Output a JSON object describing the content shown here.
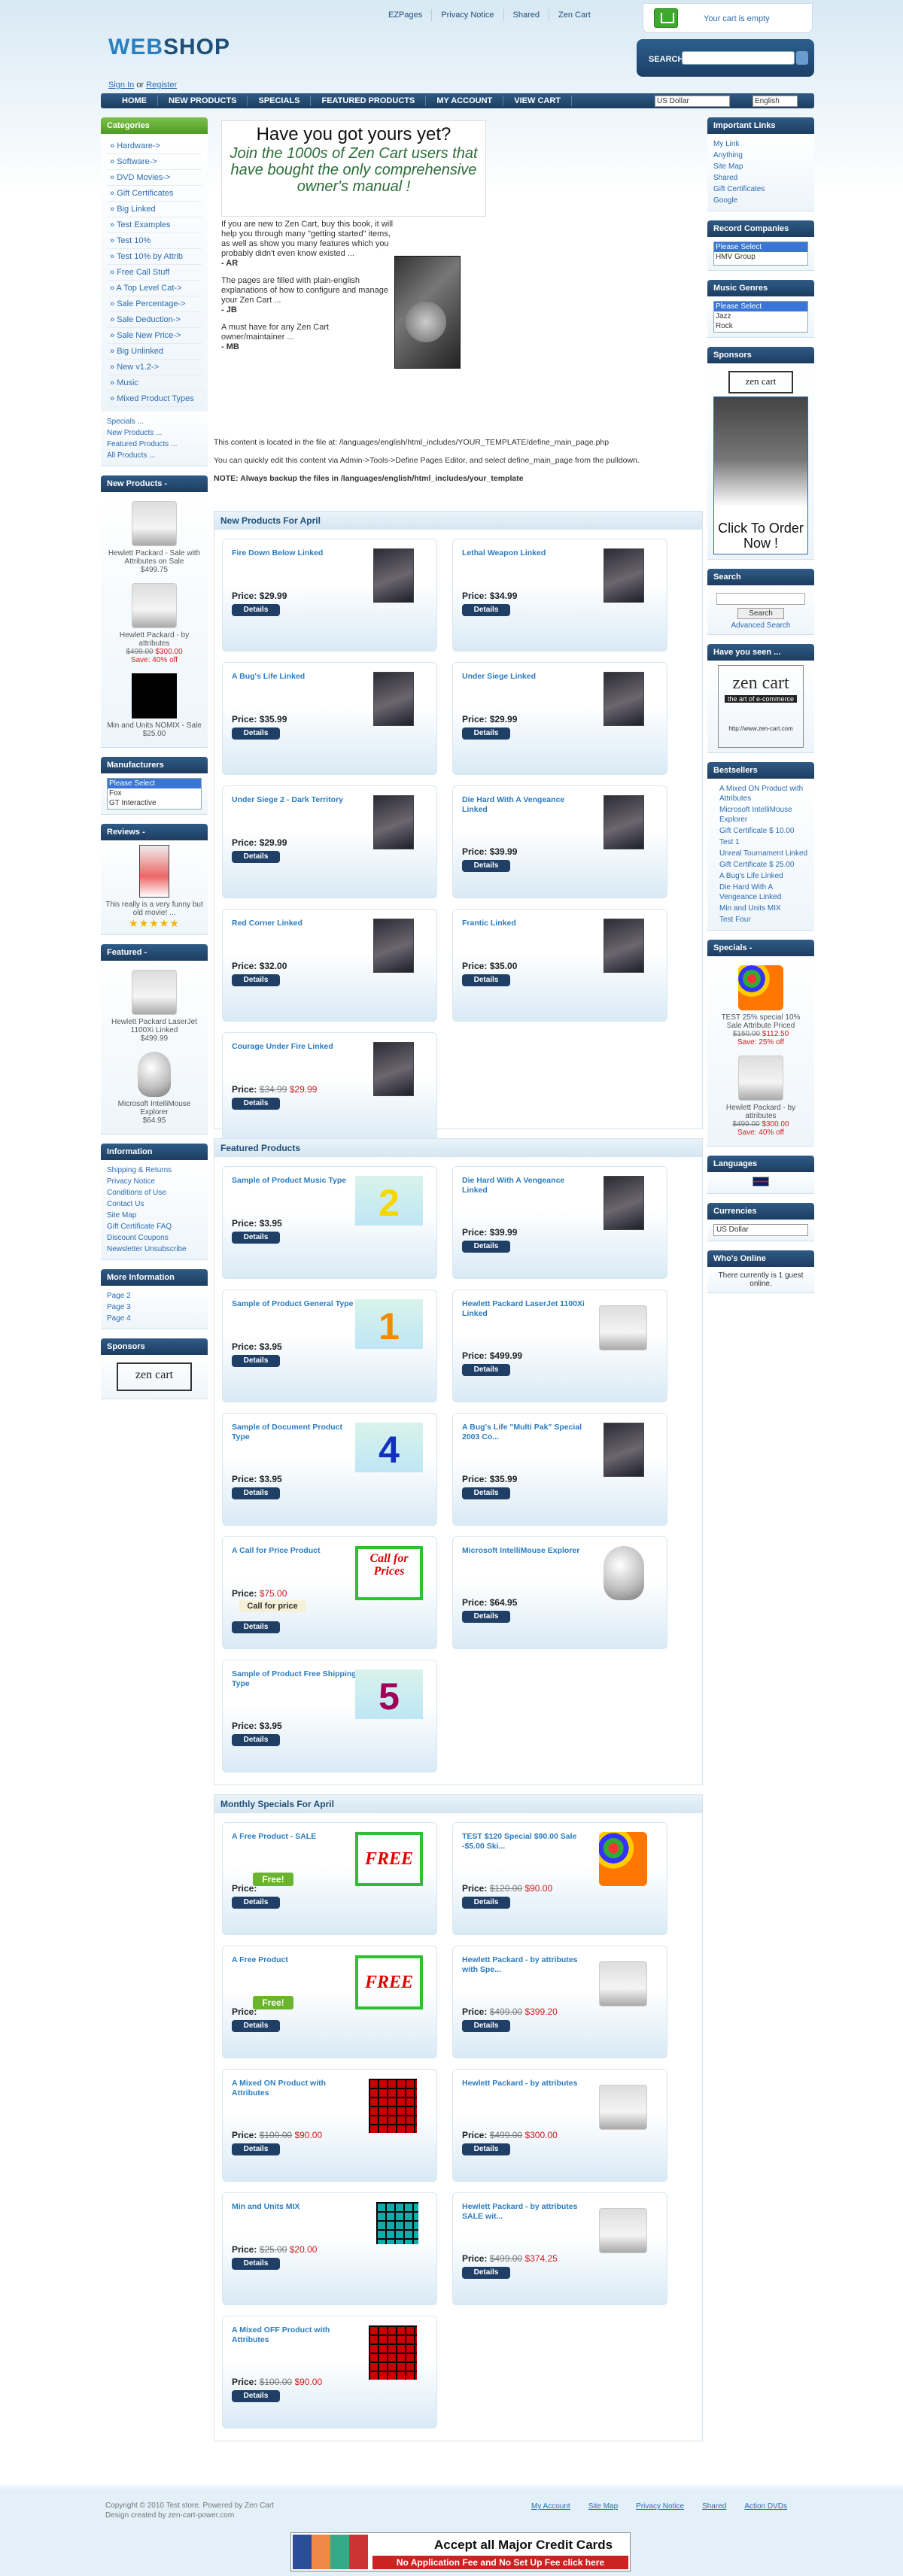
{
  "header": {
    "top_links": [
      "EZPages",
      "Privacy Notice",
      "Shared",
      "Zen Cart"
    ],
    "cart_text": "Your cart is empty",
    "logo_text": "WEB",
    "logo_bold": "SHOP",
    "search_label": "SEARCH",
    "signin": "Sign In",
    "or": "or",
    "register": "Register",
    "nav": [
      "HOME",
      "NEW PRODUCTS",
      "SPECIALS",
      "FEATURED PRODUCTS",
      "MY ACCOUNT",
      "VIEW CART"
    ],
    "currency": "US Dollar",
    "language": "English"
  },
  "left": {
    "categories_title": "Categories",
    "categories": [
      "Hardware->",
      "Software->",
      "DVD Movies->",
      "Gift Certificates",
      "Big Linked",
      "Test Examples",
      "Test 10%",
      "Test 10% by Attrib",
      "Free Call Stuff",
      "A Top Level Cat->",
      "Sale Percentage->",
      "Sale Deduction->",
      "Sale New Price->",
      "Big Unlinked",
      "New v1.2->",
      "Music",
      "Mixed Product Types"
    ],
    "category_links": [
      "Specials ...",
      "New Products ...",
      "Featured Products ...",
      "All Products ..."
    ],
    "new_products_title": "New Products - ",
    "new_products": [
      {
        "name": "Hewlett Packard - Sale with Attributes on Sale",
        "price": "$499.75",
        "old": "",
        "pct": ""
      },
      {
        "name": "Hewlett Packard - by attributes",
        "price": "$300.00",
        "old": "$499.00",
        "pct": "Save: 40% off"
      },
      {
        "name": "Min and Units NOMIX - Sale",
        "price": "$25.00",
        "old": "",
        "pct": ""
      }
    ],
    "manufacturers_title": "Manufacturers",
    "manufacturers": [
      "Please Select",
      "Fox",
      "GT Interactive"
    ],
    "reviews_title": "Reviews - ",
    "review_text": "This really is a very funny but old movie! ...",
    "stars": "★★★★★",
    "featured_title": "Featured - ",
    "featured": [
      {
        "name": "Hewlett Packard LaserJet 1100Xi Linked",
        "price": "$499.99"
      },
      {
        "name": "Microsoft IntelliMouse Explorer",
        "price": "$64.95"
      }
    ],
    "information_title": "Information",
    "information": [
      "Shipping & Returns",
      "Privacy Notice",
      "Conditions of Use",
      "Contact Us",
      "Site Map",
      "Gift Certificate FAQ",
      "Discount Coupons",
      "Newsletter Unsubscribe"
    ],
    "more_info_title": "More Information",
    "more_info": [
      "Page 2",
      "Page 3",
      "Page 4"
    ],
    "sponsors_title": "Sponsors",
    "sponsor_logo": "zen cart"
  },
  "center": {
    "banner_line1": "Have you got yours yet?",
    "banner_line2": "Join the 1000s of Zen Cart users that have bought the only comprehensive owner's manual !",
    "intro1": "If you are new to Zen Cart, buy this book, it will help you through many \"getting started\" items, as well as show you many features which you probably didn't even know existed ...",
    "sig1": "- AR",
    "intro2": "The pages are filled with plain-english explanations of how to configure and manage your Zen Cart ...",
    "sig2": "- JB",
    "intro3": "A must have for any Zen Cart owner/maintainer ...",
    "sig3": "- MB",
    "define1": "This content is located in the file at: /languages/english/html_includes/YOUR_TEMPLATE/define_main_page.php",
    "define2": "You can quickly edit this content via Admin->Tools->Define Pages Editor, and select define_main_page from the pulldown.",
    "define3": "NOTE: Always backup the files in /languages/english/html_includes/your_template",
    "details_label": "Details",
    "price_label": "Price:",
    "new_title": "New Products For April",
    "new_products": [
      {
        "name": "Fire Down Below Linked",
        "price": "$29.99",
        "thumb": "movie"
      },
      {
        "name": "Lethal Weapon Linked",
        "price": "$34.99",
        "thumb": "movie"
      },
      {
        "name": "A Bug's Life Linked",
        "price": "$35.99",
        "thumb": "movie"
      },
      {
        "name": "Under Siege Linked",
        "price": "$29.99",
        "thumb": "movie"
      },
      {
        "name": "Under Siege 2 - Dark Territory",
        "price": "$29.99",
        "thumb": "movie"
      },
      {
        "name": "Die Hard With A Vengeance Linked",
        "price": "$39.99",
        "thumb": "movie"
      },
      {
        "name": "Red Corner Linked",
        "price": "$32.00",
        "thumb": "movie"
      },
      {
        "name": "Frantic Linked",
        "price": "$35.00",
        "thumb": "movie"
      },
      {
        "name": "Courage Under Fire Linked",
        "price": "$29.99",
        "old": "$34.99",
        "thumb": "movie"
      }
    ],
    "featured_title": "Featured Products",
    "featured_products": [
      {
        "name": "Sample of Product Music Type",
        "price": "$3.95",
        "thumb": "num",
        "num": "2",
        "numcolor": "#f5d800"
      },
      {
        "name": "Die Hard With A Vengeance Linked",
        "price": "$39.99",
        "thumb": "movie"
      },
      {
        "name": "Sample of Product General Type",
        "price": "$3.95",
        "thumb": "num",
        "num": "1",
        "numcolor": "#f08a00"
      },
      {
        "name": "Hewlett Packard LaserJet 1100Xi Linked",
        "price": "$499.99",
        "thumb": "printer"
      },
      {
        "name": "Sample of Document Product Type",
        "price": "$3.95",
        "thumb": "num",
        "num": "4",
        "numcolor": "#1030c0"
      },
      {
        "name": "A Bug's Life \"Multi Pak\" Special 2003 Co...",
        "price": "$35.99",
        "thumb": "movie"
      },
      {
        "name": "A Call for Price Product",
        "price": "$75.00",
        "call": "Call for price",
        "thumb": "call",
        "thumbtext": "Call for Prices"
      },
      {
        "name": "Microsoft IntelliMouse Explorer",
        "price": "$64.95",
        "thumb": "mouse"
      },
      {
        "name": "Sample of Product Free Shipping Type",
        "price": "$3.95",
        "thumb": "num",
        "num": "5",
        "numcolor": "#a0005a"
      }
    ],
    "specials_title": "Monthly Specials For April",
    "specials": [
      {
        "name": "A Free Product - SALE",
        "free": "Free!",
        "thumb": "free",
        "thumbtext": "FREE"
      },
      {
        "name": "TEST $120 Special $90.00 Sale -$5.00 Ski...",
        "price": "$90.00",
        "old": "$120.00",
        "thumb": "buttons"
      },
      {
        "name": "A Free Product",
        "free": "Free!",
        "thumb": "free",
        "thumbtext": "FREE"
      },
      {
        "name": "Hewlett Packard - by attributes with Spe...",
        "price": "$399.20",
        "old": "$499.00",
        "thumb": "printer"
      },
      {
        "name": "A Mixed ON Product with Attributes",
        "price": "$90.00",
        "old": "$100.00",
        "thumb": "gridred"
      },
      {
        "name": "Hewlett Packard - by attributes",
        "price": "$300.00",
        "old": "$499.00",
        "thumb": "printer"
      },
      {
        "name": "Min and Units MIX",
        "price": "$20.00",
        "old": "$25.00",
        "thumb": "gridteal"
      },
      {
        "name": "Hewlett Packard - by attributes SALE wit...",
        "price": "$374.25",
        "old": "$499.00",
        "thumb": "printer"
      },
      {
        "name": "A Mixed OFF Product with Attributes",
        "price": "$90.00",
        "old": "$100.00",
        "thumb": "gridred"
      }
    ]
  },
  "right": {
    "important_title": "Important Links",
    "important": [
      "My Link",
      "Anything",
      "Site Map",
      "Shared",
      "Gift Certificates",
      "Google"
    ],
    "record_title": "Record Companies",
    "record": [
      "Please Select",
      "HMV Group"
    ],
    "music_title": "Music Genres",
    "music": [
      "Please Select",
      "Jazz",
      "Rock"
    ],
    "sponsors_title": "Sponsors",
    "sponsor_logo": "zen cart",
    "order_text": "Click To Order Now !",
    "search_title": "Search",
    "search_btn": "Search",
    "adv_search": "Advanced Search",
    "seen_title": "Have you seen ...",
    "seen_logo": "zen cart",
    "seen_sub": "the art of e-commerce",
    "seen_url": "http://www.zen-cart.com",
    "bestsellers_title": "Bestsellers",
    "bestsellers": [
      "A Mixed ON Product with Attributes",
      "Microsoft IntelliMouse Explorer",
      "Gift Certificate $ 10.00",
      "Test 1",
      "Unreal Tournament Linked",
      "Gift Certificate $ 25.00",
      "A Bug's Life Linked",
      "Die Hard With A Vengeance Linked",
      "Min and Units MIX",
      "Test Four"
    ],
    "specials_title": "Specials - ",
    "specials": [
      {
        "name": "TEST 25% special 10% Sale Attribute Priced",
        "old": "$150.00",
        "price": "$112.50",
        "pct": "Save: 25% off"
      },
      {
        "name": "Hewlett Packard - by attributes",
        "old": "$499.00",
        "price": "$300.00",
        "pct": "Save: 40% off"
      }
    ],
    "languages_title": "Languages",
    "currencies_title": "Currencies",
    "currency": "US Dollar",
    "whos_title": "Who's Online",
    "whos_text": "There currently is 1 guest online."
  },
  "footer": {
    "copy": "Copyright © 2010 Test store. Powered by Zen Cart",
    "design": "Design created by zen-cart-power.com",
    "links": [
      "My Account",
      "Site Map",
      "Privacy Notice",
      "Shared",
      "Action DVDs"
    ],
    "cc_title": "Accept all Major Credit Cards",
    "cc_sub": "No Application Fee and No Set Up Fee   click here"
  }
}
